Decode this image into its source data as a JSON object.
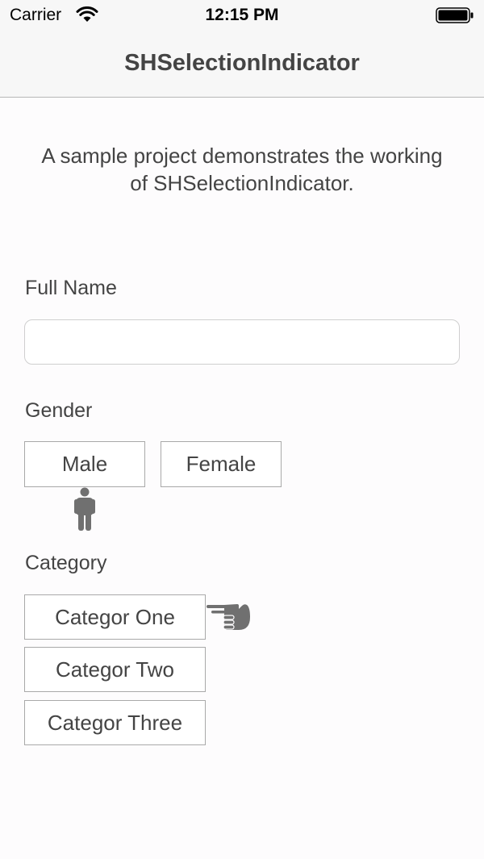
{
  "status_bar": {
    "carrier": "Carrier",
    "time": "12:15 PM",
    "wifi_icon": "wifi-icon",
    "battery_icon": "battery-icon"
  },
  "nav": {
    "title": "SHSelectionIndicator"
  },
  "description": "A sample project demonstrates the working of SHSelectionIndicator.",
  "full_name": {
    "label": "Full Name",
    "value": "",
    "placeholder": ""
  },
  "gender": {
    "label": "Gender",
    "options": [
      "Male",
      "Female"
    ],
    "selected": "Male",
    "indicator_icon": "male-person-icon"
  },
  "category": {
    "label": "Category",
    "options": [
      "Categor One",
      "Categor Two",
      "Categor Three"
    ],
    "selected": "Categor One",
    "indicator_icon": "pointing-hand-icon"
  },
  "colors": {
    "background": "#fdfcfd",
    "bar": "#f7f7f7",
    "text": "#444444",
    "icon": "#707070",
    "border": "#a9a9a9"
  }
}
